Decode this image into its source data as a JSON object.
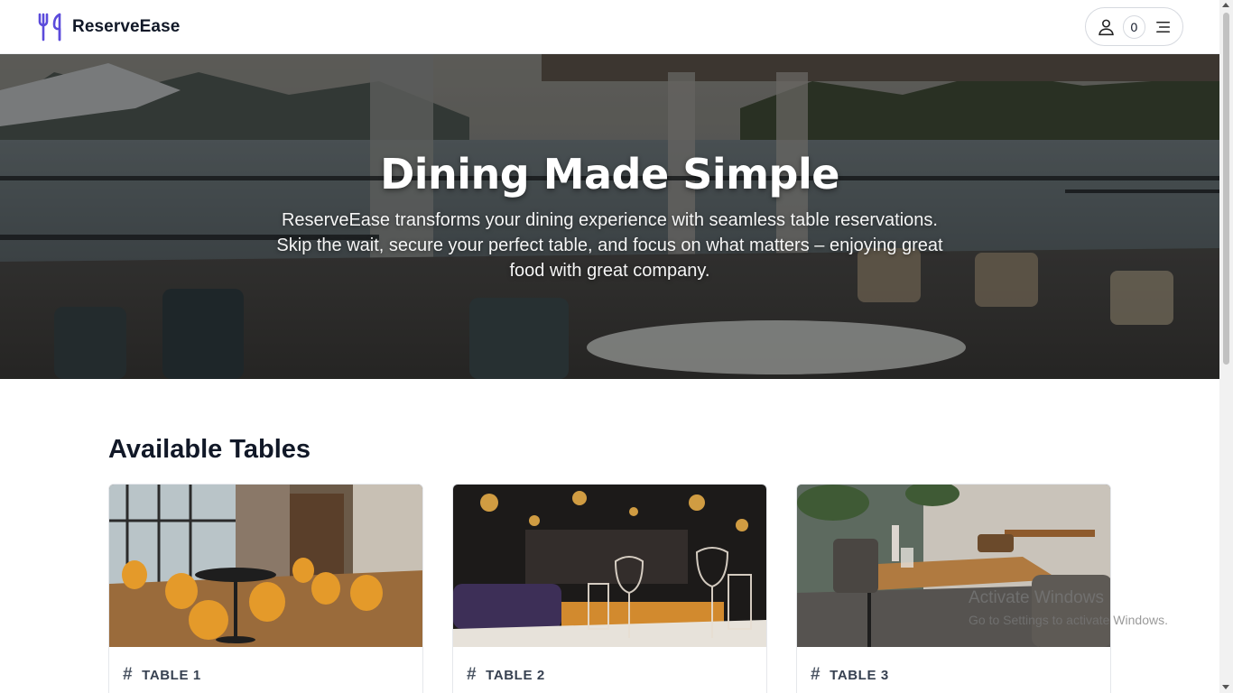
{
  "header": {
    "brand_name": "ReserveEase",
    "cart_count": "0",
    "accent_color": "#5b4bdb"
  },
  "hero": {
    "title": "Dining Made Simple",
    "subtitle": "ReserveEase transforms your dining experience with seamless table reservations. Skip the wait, secure your perfect table, and focus on what matters – enjoying great food with great company."
  },
  "tables_section": {
    "title": "Available Tables",
    "cards": [
      {
        "label": "TABLE 1"
      },
      {
        "label": "TABLE 2"
      },
      {
        "label": "TABLE 3"
      }
    ]
  },
  "watermark": {
    "title": "Activate Windows",
    "subtitle": "Go to Settings to activate Windows."
  }
}
